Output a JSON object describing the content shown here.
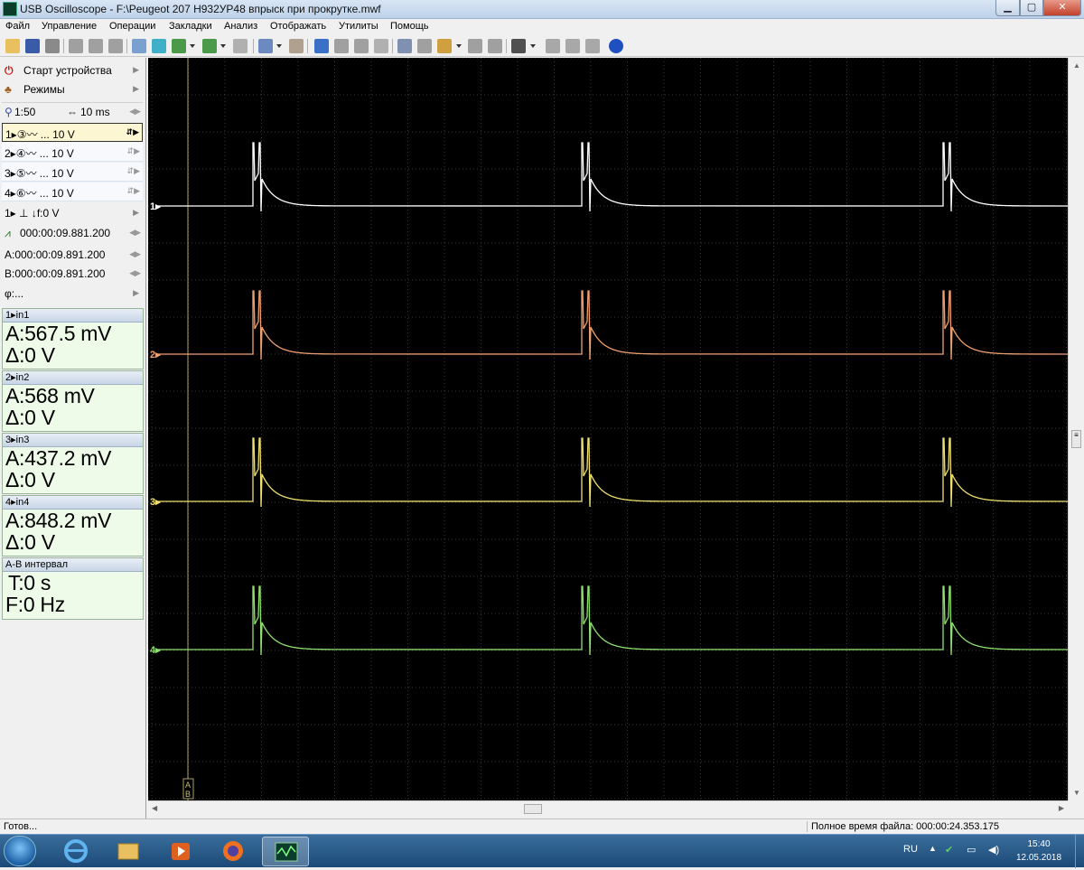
{
  "window": {
    "title": "USB Oscilloscope - F:\\Peugeot 207 H932УР48 впрыск при прокрутке.mwf"
  },
  "menu": [
    "Файл",
    "Управление",
    "Операции",
    "Закладки",
    "Анализ",
    "Отображать",
    "Утилиты",
    "Помощь"
  ],
  "left_panel": {
    "start_device": "Старт устройства",
    "modes": "Режимы",
    "zoom": "1:50",
    "timebase": "10 ms",
    "channels": [
      {
        "label": "1▸③〰 ... 10 V",
        "selected": true
      },
      {
        "label": "2▸④〰 ... 10 V",
        "selected": false
      },
      {
        "label": "3▸⑤〰 ... 10 V",
        "selected": false
      },
      {
        "label": "4▸⑥〰 ... 10 V",
        "selected": false
      }
    ],
    "trigger": "1▸ ⊥ ↓f:0 V",
    "trigger_time": "000:00:09.881.200",
    "cursor_a": "A:000:00:09.891.200",
    "cursor_b": "B:000:00:09.891.200",
    "phi": "φ:..."
  },
  "measurements": [
    {
      "header": "1▸in1",
      "a": "A:567.5 mV",
      "delta": "Δ:0 V"
    },
    {
      "header": "2▸in2",
      "a": "A:568 mV",
      "delta": "Δ:0 V"
    },
    {
      "header": "3▸in3",
      "a": "A:437.2 mV",
      "delta": "Δ:0 V"
    },
    {
      "header": "4▸in4",
      "a": "A:848.2 mV",
      "delta": "Δ:0 V"
    }
  ],
  "interval": {
    "header": "A-B интервал",
    "t": "T:0 s",
    "f": "F:0 Hz"
  },
  "scope": {
    "channel_markers": [
      "1▸",
      "2▸",
      "3▸",
      "4▸"
    ],
    "channel_colors": [
      "#ffffff",
      "#f0a070",
      "#f0e070",
      "#90e070"
    ],
    "cursor_label": "AB",
    "grid_color": "#3a3a3a",
    "cursor_color": "#a8a060"
  },
  "status": {
    "left": "Готов...",
    "right": "Полное время файла: 000:00:24.353.175"
  },
  "taskbar": {
    "lang": "RU",
    "time": "15:40",
    "date": "12.05.2018"
  }
}
